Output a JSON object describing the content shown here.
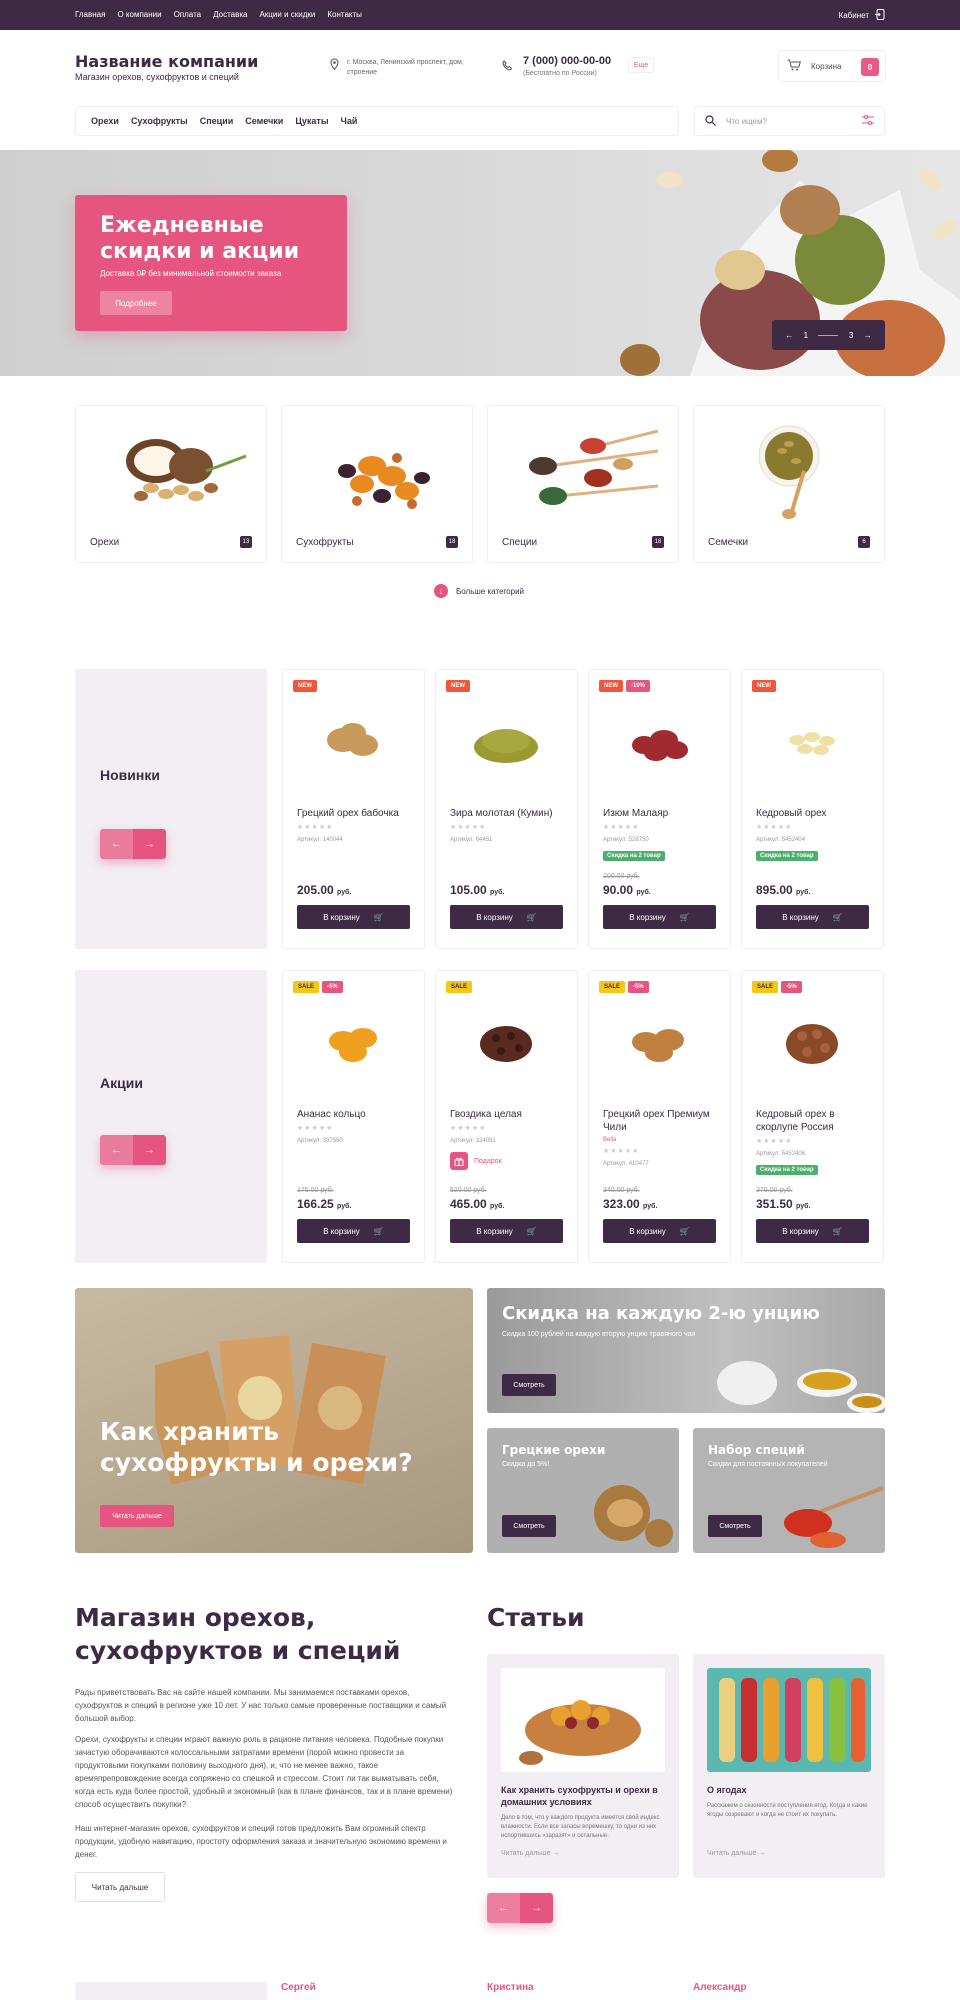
{
  "topbar": {
    "nav": [
      "Главная",
      "О компании",
      "Оплата",
      "Доставка",
      "Акции и скидки",
      "Контакты"
    ],
    "cabinet": "Кабинет"
  },
  "header": {
    "company": "Название компании",
    "tagline": "Магазин орехов, сухофруктов и специй",
    "address": "г. Москва, Ленинский проспект, дом, строение",
    "phone": "7 (000) 000-00-00",
    "phone_note": "(Бесплатно по России)",
    "phone_more": "Еще",
    "cart_label": "Корзина",
    "cart_count": "0"
  },
  "menu": [
    "Орехи",
    "Сухофрукты",
    "Специи",
    "Семечки",
    "Цукаты",
    "Чай"
  ],
  "search": {
    "placeholder": "Что ищем?"
  },
  "hero": {
    "title": "Ежедневные скидки и акции",
    "subtitle": "Доставка 0₽ без минимальной стоимости заказа",
    "button": "Подробнее",
    "slide_current": "1",
    "slide_total": "3"
  },
  "categories": [
    {
      "name": "Орехи",
      "count": "13"
    },
    {
      "name": "Сухофрукты",
      "count": "18"
    },
    {
      "name": "Специи",
      "count": "18"
    },
    {
      "name": "Семечки",
      "count": "6"
    }
  ],
  "more_categories": "Больше категорий",
  "new_section": {
    "title": "Новинки",
    "products": [
      {
        "badges": [
          "NEW"
        ],
        "name": "Грецкий орех бабочка",
        "stars": "★★★★★",
        "sku": "Артикул: 140044",
        "price": "205.00",
        "cur": "руб.",
        "cart": "В корзину"
      },
      {
        "badges": [
          "NEW"
        ],
        "name": "Зира молотая (Кумин)",
        "stars": "★★★★★",
        "sku": "Артикул: 64451",
        "price": "105.00",
        "cur": "руб.",
        "cart": "В корзину"
      },
      {
        "badges": [
          "NEW",
          "-10%"
        ],
        "name": "Изюм Малаяр",
        "stars": "★★★★★",
        "sku": "Артикул: 528750",
        "deal": "Скидка на 2 товар",
        "old": "100.00 руб.",
        "price": "90.00",
        "cur": "руб.",
        "cart": "В корзину"
      },
      {
        "badges": [
          "NEW"
        ],
        "name": "Кедровый орех",
        "stars": "★★★★★",
        "sku": "Артикул: 5452404",
        "deal": "Скидка на 2 товар",
        "price": "895.00",
        "cur": "руб.",
        "cart": "В корзину"
      }
    ]
  },
  "sale_section": {
    "title": "Акции",
    "products": [
      {
        "badges": [
          "SALE",
          "-5%"
        ],
        "name": "Ананас кольцо",
        "stars": "★★★★★",
        "sku": "Артикул: 337550",
        "old": "175.00 руб.",
        "price": "166.25",
        "cur": "руб.",
        "cart": "В корзину"
      },
      {
        "badges": [
          "SALE"
        ],
        "name": "Гвоздика целая",
        "stars": "★★★★★",
        "sku": "Артикул: 324051",
        "gift": "Подарок",
        "old": "520.00 руб.",
        "price": "465.00",
        "cur": "руб.",
        "cart": "В корзину"
      },
      {
        "badges": [
          "SALE",
          "-5%"
        ],
        "name": "Грецкий орех Премиум Чили",
        "brand": "Bella",
        "stars": "★★★★★",
        "sku": "Артикул: 410477",
        "old": "340.00 руб.",
        "price": "323.00",
        "cur": "руб.",
        "cart": "В корзину"
      },
      {
        "badges": [
          "SALE",
          "-5%"
        ],
        "name": "Кедровый орех в скорлупе Россия",
        "stars": "★★★★★",
        "sku": "Артикул: 5452406",
        "deal": "Скидка на 2 товар",
        "old": "370.00 руб.",
        "price": "351.50",
        "cur": "руб.",
        "cart": "В корзину"
      }
    ]
  },
  "promos": {
    "big": {
      "title": "Как хранить сухофрукты и орехи?",
      "button": "Читать дальше"
    },
    "wide": {
      "title": "Скидка на каждую 2-ю унцию",
      "subtitle": "Скидка 100 рублей на каждую вторую унцию травяного чая",
      "button": "Смотреть"
    },
    "small1": {
      "title": "Грецкие орехи",
      "subtitle": "Скидка до 5%!",
      "button": "Смотреть"
    },
    "small2": {
      "title": "Набор специй",
      "subtitle": "Скидки для постоянных покупателей",
      "button": "Смотреть"
    }
  },
  "about": {
    "title": "Магазин орехов, сухофруктов и специй",
    "p1": "Рады приветствовать Вас на сайте нашей компании. Мы занимаемся поставками орехов, сухофруктов и специй в регионе уже 10 лет. У нас только самые проверенные поставщики и самый большой выбор.",
    "p2": "Орехи, сухофрукты и специи играют важную роль в рационе питания человека. Подобные покупки зачастую оборачиваются колоссальными затратами времени (порой можно провести за продуктовыми покупками половину выходного дня), и, что не менее важно, такое времяпрепровождение всегда сопряжено со спешкой и стрессом. Стоит ли так выматывать себя, когда есть куда более простой, удобный и экономный (как в плане финансов, так и в плане времени) способ осуществить покупки?",
    "p3": "Наш интернет-магазин орехов, сухофруктов и специй готов предложить Вам огромный спектр продукции, удобную навигацию, простоту оформления заказа и значительную экономию времени и денег.",
    "button": "Читать дальше"
  },
  "articles": {
    "title": "Статьи",
    "items": [
      {
        "name": "Как хранить сухофрукты и орехи в домашних условиях",
        "text": "Дело в том, что у каждого продукта имеется свой индекс влажности. Если все запасы впремешку, то одни из них испортившись «заразят» и остальные.",
        "more": "Читать дальше"
      },
      {
        "name": "О ягодах",
        "text": "Расскажем о сезонности поступления ягод. Когда и какие ягоды созревают и когда не стоит их покупать.",
        "more": "Читать дальше"
      }
    ]
  },
  "reviews": [
    "Сергей",
    "Кристина",
    "Александр"
  ],
  "colors": {
    "primary": "#3f2a46",
    "accent": "#e6557f",
    "new": "#f0573a",
    "sale": "#f5c518",
    "deal": "#4caf6b"
  }
}
